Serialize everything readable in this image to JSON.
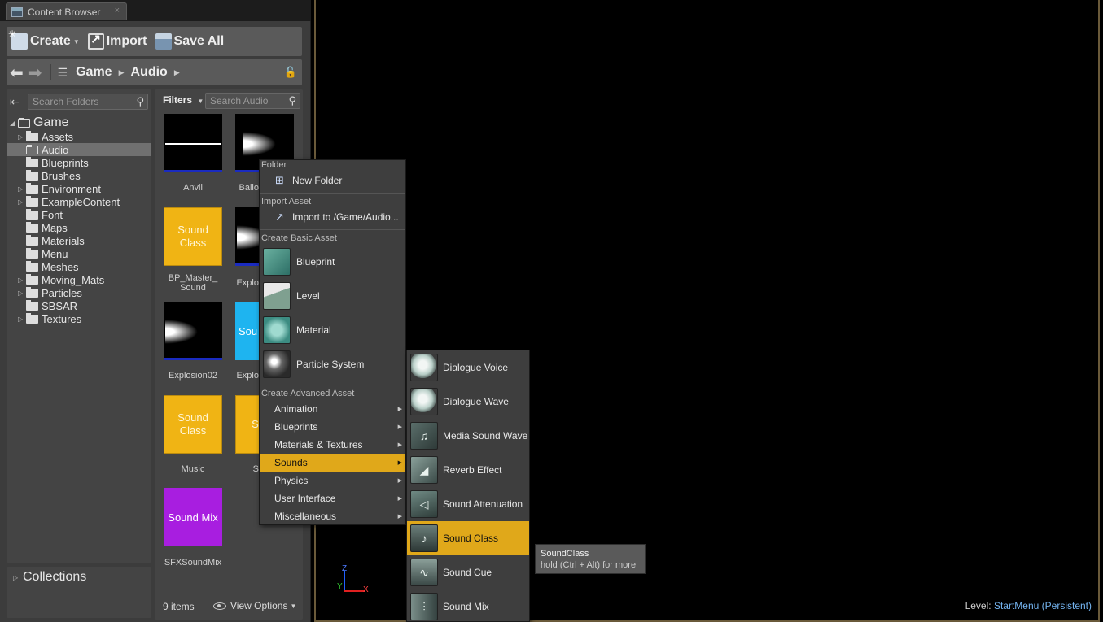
{
  "window": {
    "tab_title": "Content Browser",
    "tab_close": "×"
  },
  "toolbar": {
    "create_label": "Create",
    "import_label": "Import",
    "save_all_label": "Save All"
  },
  "navbar": {
    "breadcrumb": [
      "Game",
      "Audio"
    ]
  },
  "folder_tree": {
    "search_placeholder": "Search Folders",
    "root": "Game",
    "items": [
      {
        "label": "Assets",
        "expandable": true
      },
      {
        "label": "Audio",
        "expandable": false,
        "selected": true
      },
      {
        "label": "Blueprints",
        "expandable": false
      },
      {
        "label": "Brushes",
        "expandable": false
      },
      {
        "label": "Environment",
        "expandable": true
      },
      {
        "label": "ExampleContent",
        "expandable": true
      },
      {
        "label": "Font",
        "expandable": false
      },
      {
        "label": "Maps",
        "expandable": false
      },
      {
        "label": "Materials",
        "expandable": false
      },
      {
        "label": "Menu",
        "expandable": false
      },
      {
        "label": "Meshes",
        "expandable": false
      },
      {
        "label": "Moving_Mats",
        "expandable": true
      },
      {
        "label": "Particles",
        "expandable": true
      },
      {
        "label": "SBSAR",
        "expandable": false
      },
      {
        "label": "Textures",
        "expandable": true
      }
    ]
  },
  "collections": {
    "label": "Collections"
  },
  "asset_view": {
    "filters_label": "Filters",
    "search_placeholder": "Search Audio",
    "assets": [
      {
        "label": "Anvil",
        "tile_text": ""
      },
      {
        "label": "Ballo",
        "tile_text": ""
      },
      {
        "label": "BP_Master_ Sound",
        "tile_text": "Sound Class"
      },
      {
        "label": "Explo",
        "tile_text": ""
      },
      {
        "label": "Explosion02",
        "tile_text": ""
      },
      {
        "label": "Explo",
        "tile_text": "Sou"
      },
      {
        "label": "Music",
        "tile_text": "Sound Class"
      },
      {
        "label": "S",
        "tile_text": "So Cl"
      },
      {
        "label": "SFXSoundMix",
        "tile_text": "Sound Mix"
      }
    ],
    "items_count": "9 items",
    "view_options_label": "View Options"
  },
  "context_menu": {
    "sections": {
      "folder": "Folder",
      "import_asset": "Import Asset",
      "create_basic": "Create Basic Asset",
      "create_advanced": "Create Advanced Asset"
    },
    "new_folder": "New Folder",
    "import_to": "Import to /Game/Audio...",
    "basic_assets": [
      "Blueprint",
      "Level",
      "Material",
      "Particle System"
    ],
    "advanced": [
      "Animation",
      "Blueprints",
      "Materials & Textures",
      "Sounds",
      "Physics",
      "User Interface",
      "Miscellaneous"
    ],
    "active_advanced": "Sounds"
  },
  "sounds_submenu": {
    "items": [
      "Dialogue Voice",
      "Dialogue Wave",
      "Media Sound Wave",
      "Reverb Effect",
      "Sound Attenuation",
      "Sound Class",
      "Sound Cue",
      "Sound Mix"
    ],
    "active": "Sound Class"
  },
  "tooltip": {
    "title": "SoundClass",
    "hint": "hold (Ctrl + Alt) for more"
  },
  "viewport": {
    "axis_z": "Z",
    "axis_y": "Y",
    "axis_x": "X",
    "level_label": "Level:",
    "level_value": "StartMenu (Persistent)"
  },
  "colors": {
    "accent": "#e0a81a",
    "sound_class_tile": "#f0b414",
    "sound_mix_tile": "#a81ee0",
    "blue_tile": "#1eb4f0"
  }
}
